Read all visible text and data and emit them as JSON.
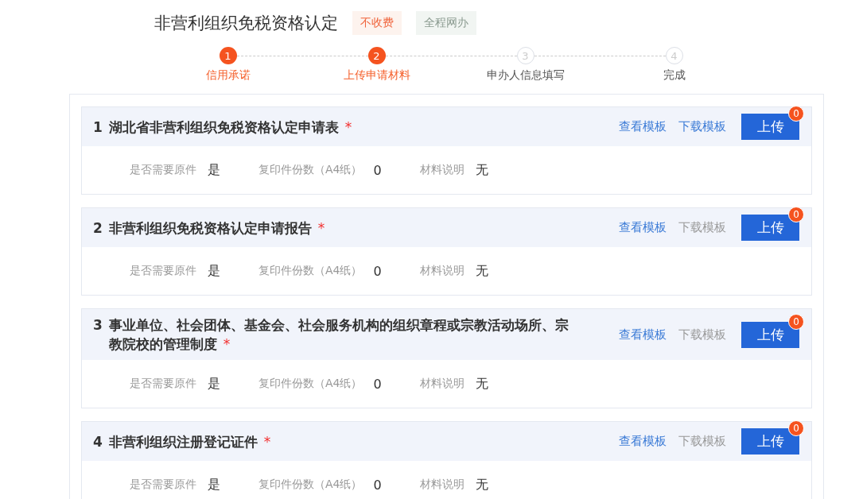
{
  "header": {
    "title": "非营利组织免税资格认定",
    "tags": [
      {
        "label": "不收费",
        "kind": "fee"
      },
      {
        "label": "全程网办",
        "kind": "online"
      }
    ]
  },
  "steps": [
    {
      "number": "1",
      "label": "信用承诺",
      "active": true
    },
    {
      "number": "2",
      "label": "上传申请材料",
      "active": true
    },
    {
      "number": "3",
      "label": "申办人信息填写",
      "active": false
    },
    {
      "number": "4",
      "label": "完成",
      "active": false
    }
  ],
  "materials": [
    {
      "number": "1",
      "title": "湖北省非营利组织免税资格认定申请表",
      "mark": "*",
      "view": "查看模板",
      "download": "下载模板",
      "download_disabled": false,
      "upload": "上传",
      "badge": "0",
      "fields": [
        {
          "label": "是否需要原件",
          "value": "是"
        },
        {
          "label": "复印件份数（A4纸）",
          "value": "0"
        },
        {
          "label": "材料说明",
          "value": "无"
        }
      ]
    },
    {
      "number": "2",
      "title": "非营利组织免税资格认定申请报告",
      "mark": "*",
      "view": "查看模板",
      "download": "下载模板",
      "download_disabled": true,
      "upload": "上传",
      "badge": "0",
      "fields": [
        {
          "label": "是否需要原件",
          "value": "是"
        },
        {
          "label": "复印件份数（A4纸）",
          "value": "0"
        },
        {
          "label": "材料说明",
          "value": "无"
        }
      ]
    },
    {
      "number": "3",
      "title": "事业单位、社会团体、基金会、社会服务机构的组织章程或宗教活动场所、宗教院校的管理制度",
      "mark": "*",
      "view": "查看模板",
      "download": "下载模板",
      "download_disabled": true,
      "upload": "上传",
      "badge": "0",
      "fields": [
        {
          "label": "是否需要原件",
          "value": "是"
        },
        {
          "label": "复印件份数（A4纸）",
          "value": "0"
        },
        {
          "label": "材料说明",
          "value": "无"
        }
      ]
    },
    {
      "number": "4",
      "title": "非营利组织注册登记证件",
      "mark": "*",
      "view": "查看模板",
      "download": "下载模板",
      "download_disabled": true,
      "upload": "上传",
      "badge": "0",
      "fields": [
        {
          "label": "是否需要原件",
          "value": "是"
        },
        {
          "label": "复印件份数（A4纸）",
          "value": "0"
        },
        {
          "label": "材料说明",
          "value": "无"
        }
      ]
    }
  ]
}
